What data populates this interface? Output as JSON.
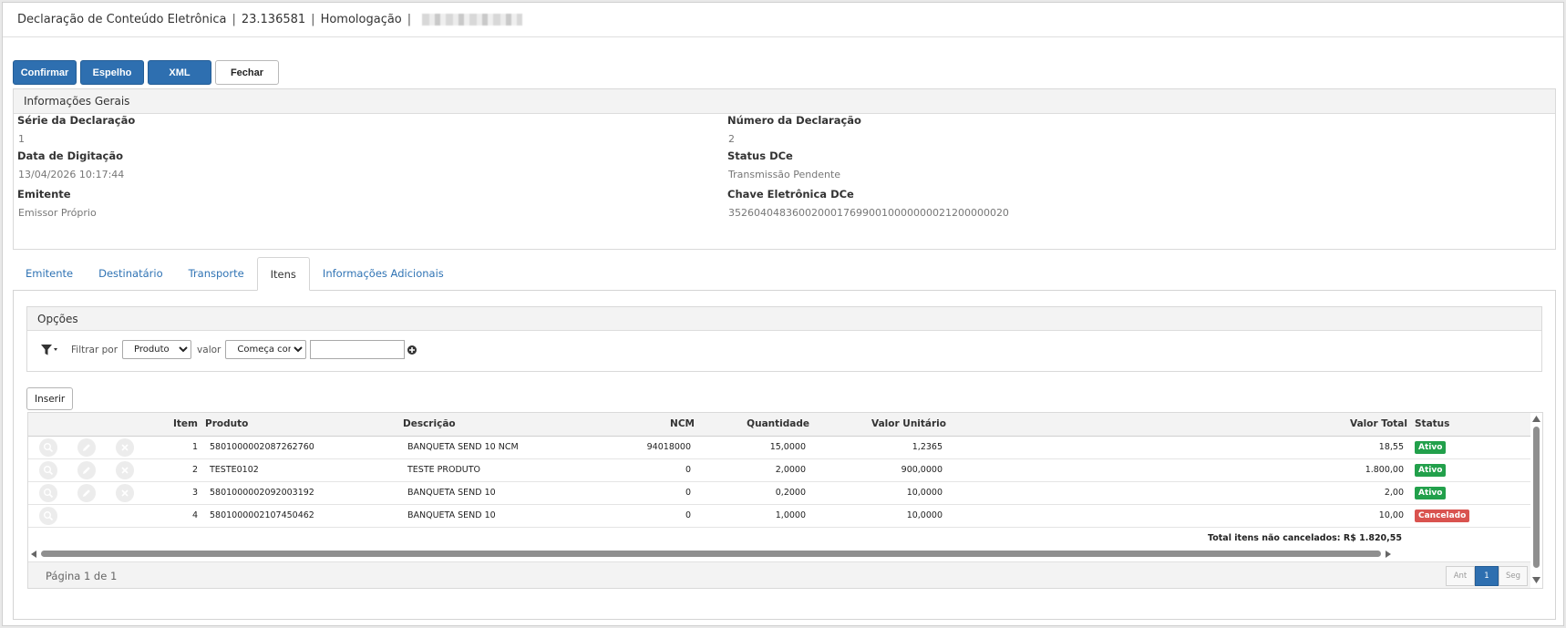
{
  "header": {
    "title": "Declaração de Conteúdo Eletrônica",
    "number": "23.136581",
    "environment": "Homologação",
    "separator": "|"
  },
  "toolbar": {
    "confirm_label": "Confirmar",
    "mirror_label": "Espelho",
    "xml_label": "XML",
    "close_label": "Fechar"
  },
  "general": {
    "title": "Informações Gerais",
    "serie_label": "Série da Declaração",
    "serie_value": "1",
    "numero_label": "Número da Declaração",
    "numero_value": "2",
    "data_label": "Data de Digitação",
    "data_value": "13/04/2026 10:17:44",
    "status_label": "Status DCe",
    "status_value": "Transmissão Pendente",
    "emitente_label": "Emitente",
    "emitente_value": "Emissor Próprio",
    "chave_label": "Chave Eletrônica DCe",
    "chave_value": "35260404836002000176990010000000021200000020"
  },
  "tabs": [
    {
      "label": "Emitente",
      "active": false
    },
    {
      "label": "Destinatário",
      "active": false
    },
    {
      "label": "Transporte",
      "active": false
    },
    {
      "label": "Itens",
      "active": true
    },
    {
      "label": "Informações Adicionais",
      "active": false
    }
  ],
  "options": {
    "title": "Opções",
    "filter_by_label": "Filtrar por",
    "filter_field_selected": "Produto",
    "value_label": "valor",
    "filter_operator_selected": "Começa com",
    "filter_value": ""
  },
  "insert_label": "Inserir",
  "grid": {
    "columns": {
      "item": "Item",
      "produto": "Produto",
      "descricao": "Descrição",
      "ncm": "NCM",
      "quantidade": "Quantidade",
      "valor_unitario": "Valor Unitário",
      "valor_total": "Valor Total",
      "status": "Status"
    },
    "rows": [
      {
        "item": "1",
        "produto": "5801000002087262760",
        "descricao": "BANQUETA SEND 10 NCM",
        "ncm": "94018000",
        "quantidade": "15,0000",
        "valor_unitario": "1,2365",
        "valor_total": "18,55",
        "status": "Ativo",
        "editable": true
      },
      {
        "item": "2",
        "produto": "TESTE0102",
        "descricao": "TESTE PRODUTO",
        "ncm": "0",
        "quantidade": "2,0000",
        "valor_unitario": "900,0000",
        "valor_total": "1.800,00",
        "status": "Ativo",
        "editable": true
      },
      {
        "item": "3",
        "produto": "5801000002092003192",
        "descricao": "BANQUETA SEND 10",
        "ncm": "0",
        "quantidade": "0,2000",
        "valor_unitario": "10,0000",
        "valor_total": "2,00",
        "status": "Ativo",
        "editable": true
      },
      {
        "item": "4",
        "produto": "5801000002107450462",
        "descricao": "BANQUETA SEND 10",
        "ncm": "0",
        "quantidade": "1,0000",
        "valor_unitario": "10,0000",
        "valor_total": "10,00",
        "status": "Cancelado",
        "editable": false
      }
    ],
    "total_label": "Total itens não cancelados: R$ 1.820,55"
  },
  "pagination": {
    "info": "Página 1 de 1",
    "prev_label": "Ant",
    "current_page": "1",
    "next_label": "Seg"
  },
  "colors": {
    "primary": "#2e6fb0",
    "link": "#2f73b4",
    "status_active": "#22a04b",
    "status_cancelled": "#d9534f"
  }
}
